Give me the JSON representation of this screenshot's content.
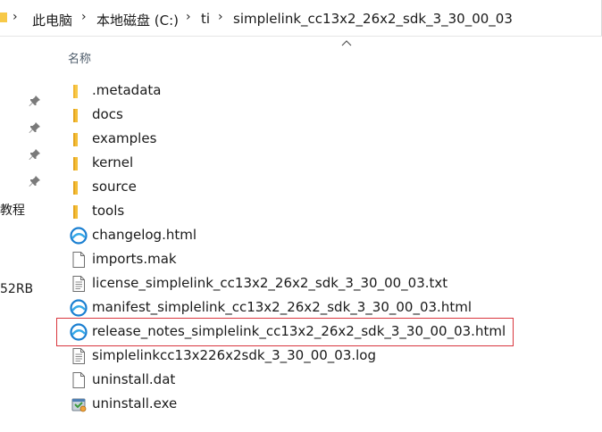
{
  "breadcrumb": {
    "items": [
      "此电脑",
      "本地磁盘 (C:)",
      "ti",
      "simplelink_cc13x2_26x2_sdk_3_30_00_03"
    ]
  },
  "column_header": {
    "name": "名称"
  },
  "nav_pane": {
    "labels": [
      "教程",
      "52RB"
    ]
  },
  "files": [
    {
      "name": ".metadata",
      "icon": "folder-icon"
    },
    {
      "name": "docs",
      "icon": "folder-icon"
    },
    {
      "name": "examples",
      "icon": "folder-icon"
    },
    {
      "name": "kernel",
      "icon": "folder-icon"
    },
    {
      "name": "source",
      "icon": "folder-icon"
    },
    {
      "name": "tools",
      "icon": "folder-icon"
    },
    {
      "name": "changelog.html",
      "icon": "browser-html-icon"
    },
    {
      "name": "imports.mak",
      "icon": "blank-file-icon"
    },
    {
      "name": "license_simplelink_cc13x2_26x2_sdk_3_30_00_03.txt",
      "icon": "text-file-icon"
    },
    {
      "name": "manifest_simplelink_cc13x2_26x2_sdk_3_30_00_03.html",
      "icon": "browser-html-icon"
    },
    {
      "name": "release_notes_simplelink_cc13x2_26x2_sdk_3_30_00_03.html",
      "icon": "browser-html-icon"
    },
    {
      "name": "simplelinkcc13x226x2sdk_3_30_00_03.log",
      "icon": "text-file-icon"
    },
    {
      "name": "uninstall.dat",
      "icon": "blank-file-icon"
    },
    {
      "name": "uninstall.exe",
      "icon": "installer-exe-icon"
    }
  ],
  "colors": {
    "folder": "#f7c948",
    "browser_icon": "#1a7fd1",
    "highlight_border": "#d9363e"
  }
}
